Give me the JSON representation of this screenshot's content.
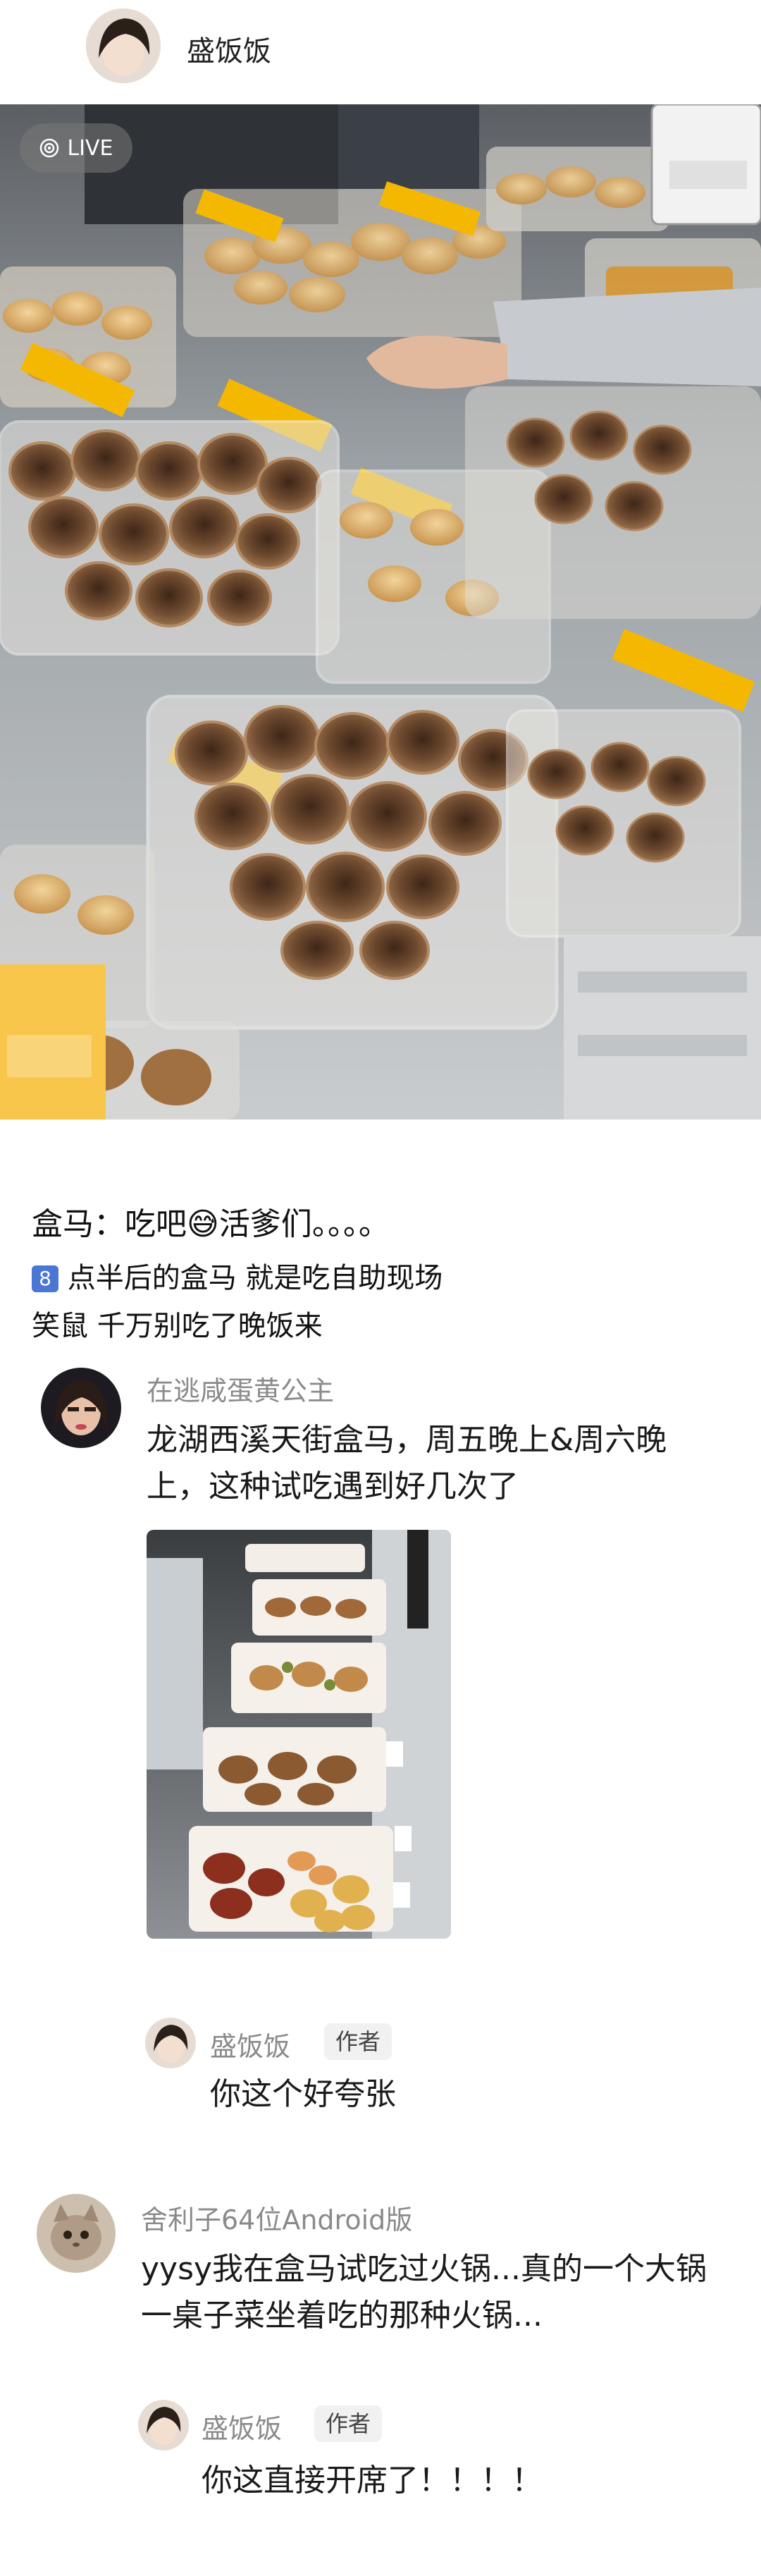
{
  "post": {
    "author": "盛饭饭",
    "live_label": "LIVE",
    "caption_line1": "盒马：吃吧😅活爹们。。。。",
    "caption_line2_badge": "8",
    "caption_line2": "点半后的盒马 就是吃自助现场",
    "caption_line3": "笑鼠 千万别吃了晚饭来"
  },
  "comments": [
    {
      "name": "在逃咸蛋黄公主",
      "text_line1": "龙湖西溪天街盒马，周五晚上&周六晚",
      "text_line2": "上，这种试吃遇到好几次了",
      "reply": {
        "name": "盛饭饭",
        "tag": "作者",
        "text": "你这个好夸张"
      }
    },
    {
      "name": "舍利子64位Android版",
      "text_line1": "yysy我在盒马试吃过火锅...真的一个大锅",
      "text_line2": "一桌子菜坐着吃的那种火锅...",
      "reply": {
        "name": "盛饭饭",
        "tag": "作者",
        "text": "你这直接开席了！！！！"
      }
    }
  ],
  "colors": {
    "name_gray": "#8a8a8a",
    "tag_bg": "#f1f1f1",
    "pastry_brown": "#8b5a34",
    "label_yellow": "#f5b800"
  }
}
